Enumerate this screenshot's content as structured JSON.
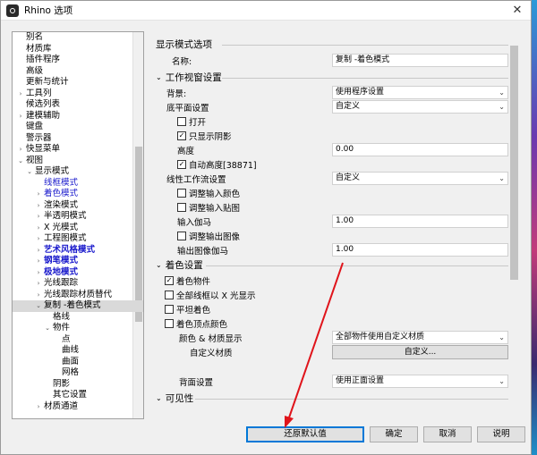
{
  "window": {
    "title": "Rhino 选项",
    "close_glyph": "✕"
  },
  "tree": [
    {
      "label": "别名",
      "indent": 0,
      "arrow": ""
    },
    {
      "label": "材质库",
      "indent": 0,
      "arrow": ""
    },
    {
      "label": "插件程序",
      "indent": 0,
      "arrow": ""
    },
    {
      "label": "高级",
      "indent": 0,
      "arrow": ""
    },
    {
      "label": "更新与统计",
      "indent": 0,
      "arrow": ""
    },
    {
      "label": "工具列",
      "indent": 0,
      "arrow": "›"
    },
    {
      "label": "候选列表",
      "indent": 0,
      "arrow": ""
    },
    {
      "label": "建模辅助",
      "indent": 0,
      "arrow": "›"
    },
    {
      "label": "键盘",
      "indent": 0,
      "arrow": ""
    },
    {
      "label": "警示器",
      "indent": 0,
      "arrow": ""
    },
    {
      "label": "快显菜单",
      "indent": 0,
      "arrow": "›"
    },
    {
      "label": "视图",
      "indent": 0,
      "arrow": "⌄"
    },
    {
      "label": "显示模式",
      "indent": 1,
      "arrow": "⌄"
    },
    {
      "label": "线框模式",
      "indent": 2,
      "arrow": "",
      "style": "blue2"
    },
    {
      "label": "着色模式",
      "indent": 2,
      "arrow": "›",
      "style": "blue2"
    },
    {
      "label": "渲染模式",
      "indent": 2,
      "arrow": "›"
    },
    {
      "label": "半透明模式",
      "indent": 2,
      "arrow": "›"
    },
    {
      "label": "X 光模式",
      "indent": 2,
      "arrow": "›"
    },
    {
      "label": "工程图模式",
      "indent": 2,
      "arrow": "›"
    },
    {
      "label": "艺术风格模式",
      "indent": 2,
      "arrow": "›",
      "style": "blue"
    },
    {
      "label": "钢笔模式",
      "indent": 2,
      "arrow": "›",
      "style": "blue"
    },
    {
      "label": "极地模式",
      "indent": 2,
      "arrow": "›",
      "style": "blue"
    },
    {
      "label": "光线跟踪",
      "indent": 2,
      "arrow": "›"
    },
    {
      "label": "光线跟踪材质替代",
      "indent": 2,
      "arrow": "›"
    },
    {
      "label": "复制 -着色模式",
      "indent": 2,
      "arrow": "⌄",
      "selected": true
    },
    {
      "label": "格线",
      "indent": 3,
      "arrow": ""
    },
    {
      "label": "物件",
      "indent": 3,
      "arrow": "⌄"
    },
    {
      "label": "点",
      "indent": 4,
      "arrow": ""
    },
    {
      "label": "曲线",
      "indent": 4,
      "arrow": ""
    },
    {
      "label": "曲面",
      "indent": 4,
      "arrow": ""
    },
    {
      "label": "网格",
      "indent": 4,
      "arrow": ""
    },
    {
      "label": "阴影",
      "indent": 3,
      "arrow": ""
    },
    {
      "label": "其它设置",
      "indent": 3,
      "arrow": ""
    },
    {
      "label": "材质通道",
      "indent": 2,
      "arrow": "›"
    }
  ],
  "panel": {
    "sec_display": "显示模式选项",
    "name_label": "名称:",
    "name_value": "复制 -着色模式",
    "sec_viewport": "工作视窗设置",
    "bg_label": "背景:",
    "bg_value": "使用程序设置",
    "ground_label": "底平面设置",
    "ground_value": "自定义",
    "open_label": "打开",
    "shadow_only_label": "只显示阴影",
    "height_label": "高度",
    "height_value": "0.00",
    "auto_height_label": "自动高度[38871]",
    "linear_label": "线性工作流设置",
    "linear_value": "自定义",
    "adjust_color_label": "调整输入颜色",
    "adjust_map_label": "调整输入贴图",
    "gamma_in_label": "输入伽马",
    "gamma_in_value": "1.00",
    "adjust_out_label": "调整输出图像",
    "gamma_out_label": "输出图像伽马",
    "gamma_out_value": "1.00",
    "sec_shading": "着色设置",
    "shade_obj_label": "着色物件",
    "all_xray_label": "全部线框以 X 光显示",
    "flat_label": "平坦着色",
    "vertex_color_label": "着色顶点颜色",
    "color_mat_label": "颜色 & 材质显示",
    "color_mat_value": "全部物件使用自定义材质",
    "custom_mat_label": "自定义材质",
    "custom_btn": "自定义...",
    "backface_label": "背面设置",
    "backface_value": "使用正面设置",
    "sec_visibility": "可见性",
    "check_glyph": "✓",
    "collapse_glyph": "⌄",
    "combo_glyph": "⌄"
  },
  "buttons": {
    "restore": "还原默认值",
    "ok": "确定",
    "cancel": "取消",
    "help": "说明"
  }
}
